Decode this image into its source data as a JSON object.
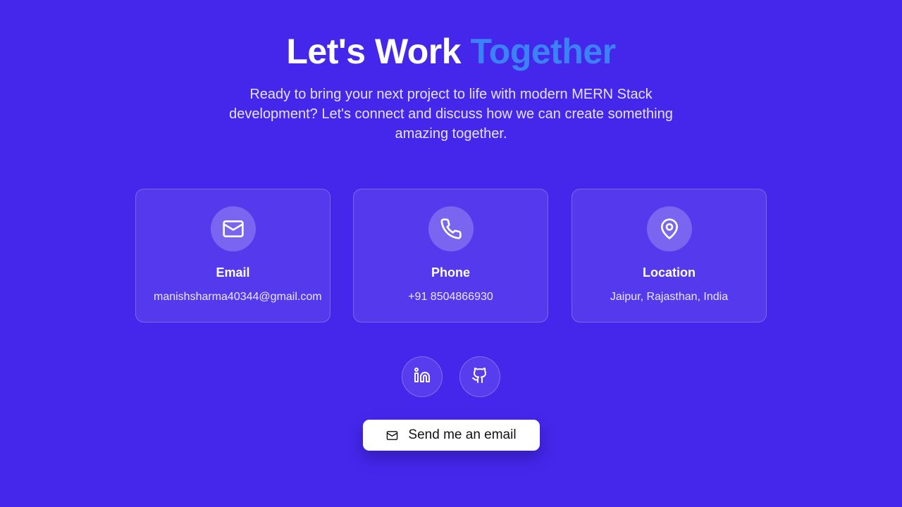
{
  "header": {
    "title_part1": "Let's Work",
    "title_accent": "Together",
    "intro": "Ready to bring your next project to life with modern MERN Stack development? Let's connect and discuss how we can create something amazing together."
  },
  "contacts": [
    {
      "title": "Email",
      "value": "manishsharma40344@gmail.com",
      "icon": "mail-icon"
    },
    {
      "title": "Phone",
      "value": "+91 8504866930",
      "icon": "phone-icon"
    },
    {
      "title": "Location",
      "value": "Jaipur, Rajasthan, India",
      "icon": "map-pin-icon"
    }
  ],
  "social": [
    {
      "icon": "linkedin-icon"
    },
    {
      "icon": "github-icon"
    }
  ],
  "cta": {
    "label": "Send me an email",
    "icon": "mail-icon"
  },
  "colors": {
    "background": "#4527ec",
    "accent": "#3b82f6",
    "button_bg": "#ffffff",
    "button_text": "#111111"
  }
}
